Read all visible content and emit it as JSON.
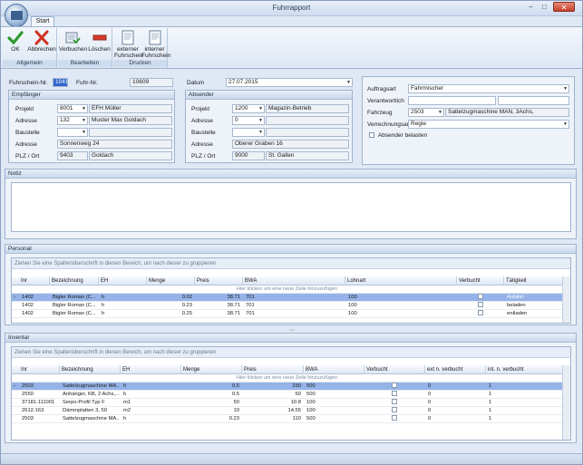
{
  "window": {
    "title": "Fuhrrapport",
    "controls": {
      "minimize": "−",
      "maximize": "□",
      "close": "✕"
    }
  },
  "ribbon": {
    "tabs": [
      {
        "label": "Start"
      }
    ],
    "groups": [
      {
        "label": "Allgemein",
        "buttons": [
          {
            "label": "OK",
            "icon": "check-icon"
          },
          {
            "label": "Abbrechen",
            "icon": "cancel-x-icon"
          }
        ]
      },
      {
        "label": "Bearbeiten",
        "buttons": [
          {
            "label": "Verbuchen",
            "icon": "book-entry-icon"
          },
          {
            "label": "Löschen",
            "icon": "delete-icon"
          }
        ]
      },
      {
        "label": "Drucken",
        "buttons": [
          {
            "label": "externer Fuhrschein",
            "line1": "externer",
            "line2": "Fuhrschein",
            "icon": "print-document-icon"
          },
          {
            "label": "interner Fuhrschein",
            "line1": "interner",
            "line2": "Fuhrschein",
            "icon": "print-document-icon"
          }
        ]
      }
    ]
  },
  "header": {
    "fuhrschein_label": "Fuhrschein-Nr.",
    "fuhrschein_value": "10412",
    "fuhr_label": "Fuhr-Nr.",
    "fuhr_value": "10609",
    "datum_label": "Datum",
    "datum_value": "27.07.2015"
  },
  "empfaenger": {
    "title": "Empfänger",
    "projekt_label": "Projekt",
    "projekt_value": "8001",
    "projekt_name": "EFH Müller",
    "adresse_label": "Adresse",
    "adresse_value": "132",
    "adresse_name": "Muster Max Goldach",
    "baustelle_label": "Baustelle",
    "baustelle_value": "",
    "baustelle_name": "",
    "adresse2_label": "Adresse",
    "adresse2_value": "Sonnenweg 24",
    "plz_label": "PLZ / Ort",
    "plz_value": "9403",
    "ort_value": "Goldach"
  },
  "absender": {
    "title": "Absender",
    "projekt_label": "Projekt",
    "projekt_value": "1200",
    "projekt_name": "Magazin-Betrieb",
    "adresse_label": "Adresse",
    "adresse_value": "0",
    "adresse_name": "",
    "baustelle_label": "Baustelle",
    "baustelle_value": "",
    "baustelle_name": "",
    "adresse2_label": "Adresse",
    "adresse2_value": "Oberer Graben 16",
    "plz_label": "PLZ / Ort",
    "plz_value": "9000",
    "ort_value": "St. Gallen"
  },
  "auftrag": {
    "auftragsart_label": "Auftragsart",
    "auftragsart_value": "Fahrmischer",
    "verantwortlich_label": "Verantwortlich",
    "verantwortlich_value": "",
    "verantwortlich_name": "",
    "fahrzeug_label": "Fahrzeug",
    "fahrzeug_value": "2503",
    "fahrzeug_name": "Sattelzugmaschine MAN, 3Achs,",
    "verrechnungsart_label": "Verrechnungsart",
    "verrechnungsart_value": "Regie",
    "absender_belasten_label": "Absender belasten"
  },
  "notiz": {
    "title": "Notiz",
    "value": ""
  },
  "personal": {
    "title": "Personal",
    "group_hint": "Ziehen Sie eine Spaltenüberschrift in diesen Bereich, um nach dieser zu gruppieren",
    "new_row_hint": "Hier klicken um eine neue Zeile hinzuzufügen",
    "columns": [
      "Inr",
      "Bezeichnung",
      "EH",
      "Menge",
      "Preis",
      "BWA",
      "Lohnart",
      "Verbucht",
      "Tätigkeit"
    ],
    "rows": [
      {
        "inr": "1402",
        "bez": "Bigler Roman (C...",
        "eh": "h",
        "menge": "0.02",
        "preis": "38.71",
        "bwa": "701",
        "lohnart": "100",
        "taetigkeit": "Anfahrt"
      },
      {
        "inr": "1402",
        "bez": "Bigler Roman (C...",
        "eh": "h",
        "menge": "0.23",
        "preis": "38.71",
        "bwa": "701",
        "lohnart": "100",
        "taetigkeit": "beladen"
      },
      {
        "inr": "1402",
        "bez": "Bigler Roman (C...",
        "eh": "h",
        "menge": "0.25",
        "preis": "38.71",
        "bwa": "701",
        "lohnart": "100",
        "taetigkeit": "entladen"
      }
    ]
  },
  "inventar": {
    "title": "Inventar",
    "group_hint": "Ziehen Sie eine Spaltenüberschrift in diesen Bereich, um nach dieser zu gruppieren",
    "new_row_hint": "Hier klicken um eine neue Zeile hinzuzufügen",
    "columns": [
      "Inr",
      "Bezeichnung",
      "EH",
      "Menge",
      "Preis",
      "BWA",
      "Verbucht",
      "ext n. verbucht",
      "int. n. verbucht"
    ],
    "rows": [
      {
        "inr": "2503",
        "bez": "Sattelzugmaschine MA...",
        "eh": "h",
        "menge": "0.5",
        "preis": "230",
        "bwa": "500",
        "ext": "0",
        "int": "1"
      },
      {
        "inr": "2550",
        "bez": "Anhänger, KB, 2 Achs,...",
        "eh": "h",
        "menge": "0.5",
        "preis": "50",
        "bwa": "500",
        "ext": "0",
        "int": "1"
      },
      {
        "inr": "37181.111001",
        "bez": "Serpo-Profil Typ F",
        "eh": "m1",
        "menge": "50",
        "preis": "10.8",
        "bwa": "100",
        "ext": "0",
        "int": "1"
      },
      {
        "inr": "2612.163",
        "bez": "Dämmplatten 3, 50",
        "eh": "m2",
        "menge": "10",
        "preis": "14.55",
        "bwa": "100",
        "ext": "0",
        "int": "1"
      },
      {
        "inr": "2503",
        "bez": "Sattelzugmaschine MA...",
        "eh": "h",
        "menge": "0.23",
        "preis": "110",
        "bwa": "500",
        "ext": "0",
        "int": "1"
      }
    ]
  }
}
